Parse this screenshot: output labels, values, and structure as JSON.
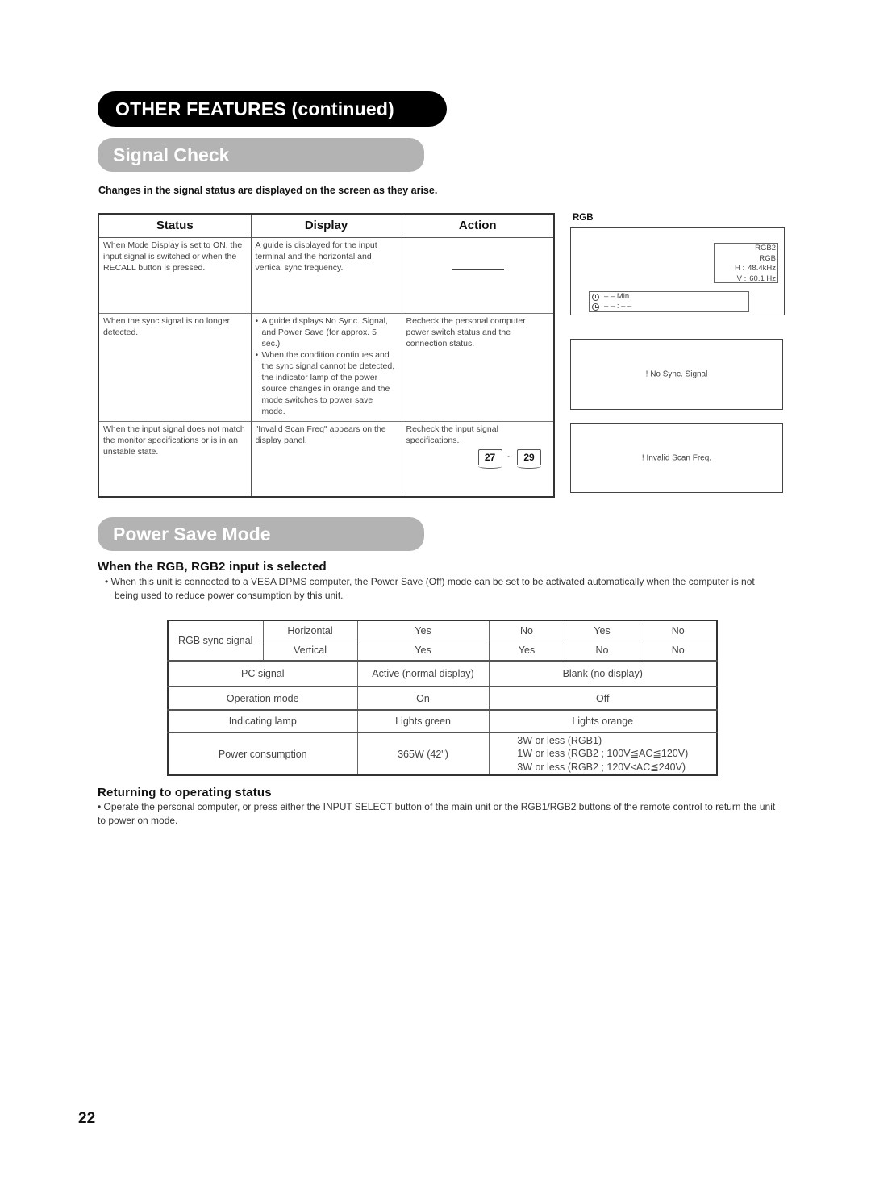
{
  "header": {
    "section_title": "OTHER FEATURES (continued)"
  },
  "signal_check": {
    "title": "Signal Check",
    "intro": "Changes in the signal status are displayed on the screen as they arise.",
    "table": {
      "headers": [
        "Status",
        "Display",
        "Action"
      ],
      "rows": [
        {
          "status": "When Mode Display is set to ON, the input signal is switched or when the RECALL button is pressed.",
          "display": [
            "A guide is displayed for the input terminal and the horizontal and vertical sync frequency."
          ],
          "action": "—",
          "action_is_dash": true
        },
        {
          "status": "When the sync signal is no longer detected.",
          "display": [
            "A guide displays No Sync. Signal, and Power Save (for approx. 5 sec.)",
            "When the condition continues and the sync signal cannot be detected, the indicator lamp of the power source changes in orange and the mode switches to power save mode."
          ],
          "action": "Recheck the personal computer power switch status and the connection status."
        },
        {
          "status": "When the input signal does not match the monitor specifications or is in an unstable state.",
          "display": [
            "\"Invalid Scan Freq\" appears on the display panel."
          ],
          "action": "Recheck the input signal specifications.",
          "page_refs": [
            "27",
            "29"
          ],
          "page_ref_separator": "~"
        }
      ]
    },
    "screens": {
      "rgb_label": "RGB",
      "rgb_osd": {
        "input": "RGB2",
        "signal": "RGB",
        "h_label": "H :",
        "h_value": "48.4kHz",
        "v_label": "V :",
        "v_value": "60.1 Hz"
      },
      "timer": {
        "sleep_icon": "sleep-timer-icon",
        "sleep_text": "– – Min.",
        "clock_icon": "clock-icon",
        "clock_text": "– – : – –"
      },
      "no_sync": "! No Sync. Signal",
      "invalid_scan": "! Invalid Scan Freq."
    }
  },
  "power_save": {
    "title": "Power Save Mode",
    "subheading": "When the RGB, RGB2 input is selected",
    "description": "• When this unit is connected to a VESA DPMS computer, the Power Save (Off) mode can be set to be activated automatically when the computer is not being used to reduce power consumption by this unit.",
    "table": {
      "sync_label": "RGB sync signal",
      "horizontal_label": "Horizontal",
      "vertical_label": "Vertical",
      "horizontal_values": [
        "Yes",
        "No",
        "Yes",
        "No"
      ],
      "vertical_values": [
        "Yes",
        "Yes",
        "No",
        "No"
      ],
      "rows": [
        {
          "label": "PC signal",
          "on": "Active (normal display)",
          "off": "Blank (no display)"
        },
        {
          "label": "Operation mode",
          "on": "On",
          "off": "Off"
        },
        {
          "label": "Indicating lamp",
          "on": "Lights green",
          "off": "Lights orange"
        }
      ],
      "power": {
        "label": "Power consumption",
        "on": "365W (42\")",
        "off_lines": [
          "3W or less (RGB1)",
          "1W or less (RGB2 ; 100V≦AC≦120V)",
          "3W or less (RGB2 ; 120V<AC≦240V)"
        ]
      }
    },
    "returning": {
      "subheading": "Returning to operating status",
      "text": "• Operate the personal computer, or press either the INPUT SELECT button of the main unit or the RGB1/RGB2 buttons of the remote control to return the unit to power on mode."
    }
  },
  "footer": {
    "page_number": "22"
  }
}
